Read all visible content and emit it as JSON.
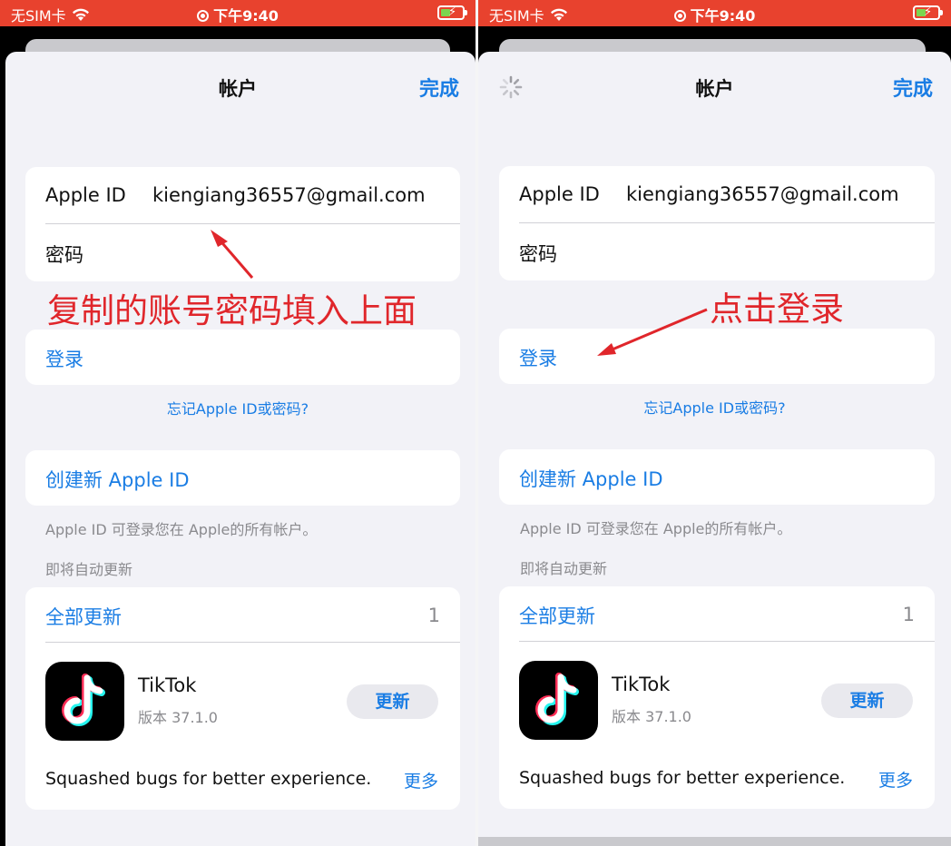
{
  "status_bar": {
    "carrier": "无SIM卡",
    "time": "下午9:40"
  },
  "nav": {
    "title": "帐户",
    "done_label": "完成"
  },
  "credentials": {
    "apple_id_label": "Apple ID",
    "apple_id_value": "kiengiang36557@gmail.com",
    "password_label": "密码"
  },
  "sign_in_label": "登录",
  "forgot_link": "忘记Apple ID或密码?",
  "create_apple_id_label": "创建新 Apple ID",
  "apple_id_footnote": "Apple ID 可登录您在 Apple的所有帐户。",
  "pending_updates_header": "即将自动更新",
  "updates": {
    "update_all_label": "全部更新",
    "count": "1",
    "app": {
      "name": "TikTok",
      "version": "版本 37.1.0",
      "update_button": "更新",
      "notes": "Squashed bugs for better experience.",
      "more_label": "更多"
    }
  },
  "annotations": {
    "left": "复制的账号密码填入上面",
    "right": "点击登录"
  },
  "colors": {
    "status_bar": "#e8422e",
    "accent": "#1a7de4",
    "annotation": "#e0262b"
  },
  "icons": [
    "wifi-icon",
    "screen-record-icon",
    "battery-charging-icon",
    "loading-spinner-icon",
    "tiktok-app-icon"
  ]
}
